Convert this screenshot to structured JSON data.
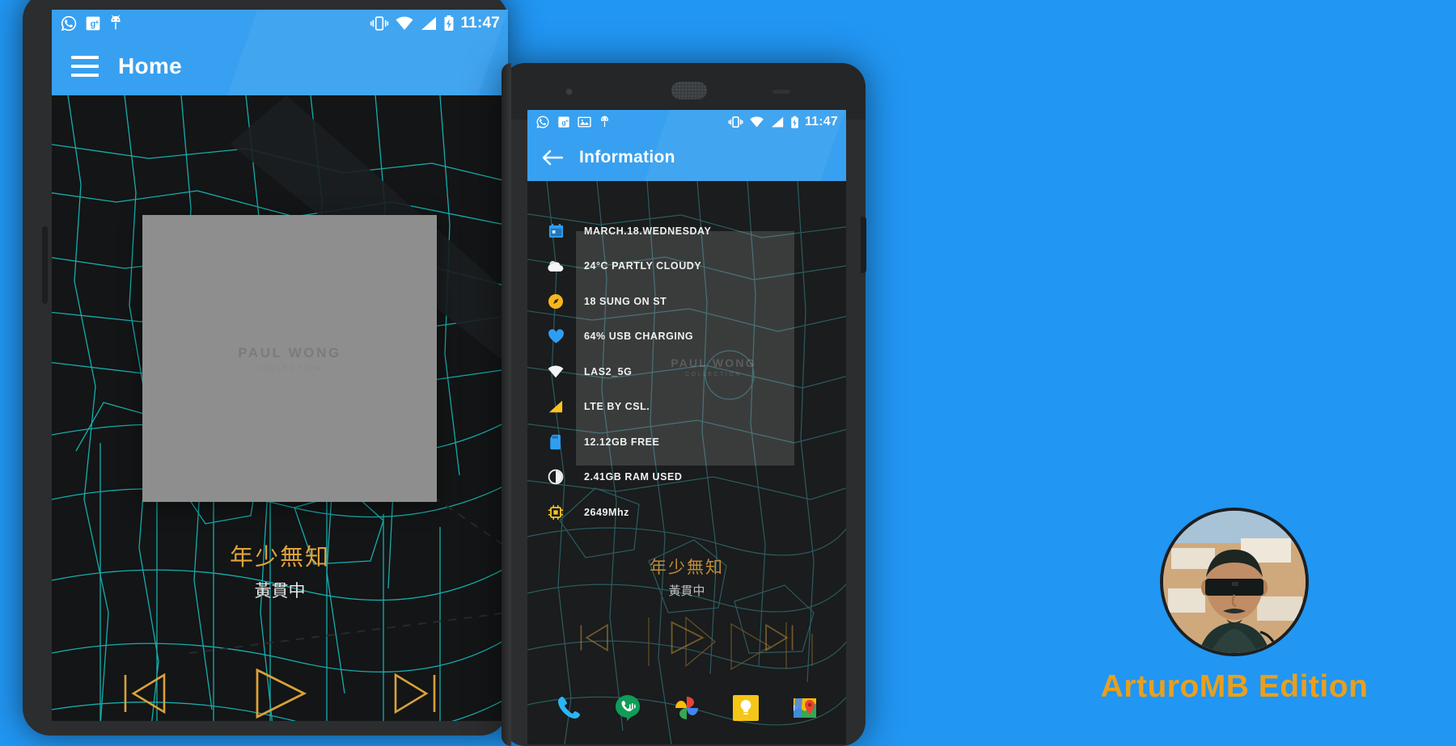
{
  "background_color": "#2196f3",
  "phone1": {
    "statusbar": {
      "time": "11:47",
      "left_icons": [
        "whatsapp-icon",
        "google-plus-icon",
        "android-icon"
      ],
      "right_icons": [
        "vibrate-icon",
        "wifi-icon",
        "signal-icon",
        "battery-charging-icon"
      ]
    },
    "appbar": {
      "title": "Home",
      "menu_icon": "hamburger-menu-icon"
    },
    "album": {
      "title": "PAUL WONG",
      "subtitle": "COLLECTION"
    },
    "now_playing": {
      "title": "年少無知",
      "artist": "黃貫中"
    },
    "controls": {
      "previous_label": "previous-track",
      "play_label": "play",
      "next_label": "next-track"
    }
  },
  "phone2": {
    "statusbar": {
      "time": "11:47",
      "left_icons": [
        "whatsapp-icon",
        "google-plus-icon",
        "screenshot-icon",
        "android-icon"
      ],
      "right_icons": [
        "vibrate-icon",
        "wifi-icon",
        "signal-icon",
        "battery-charging-icon"
      ]
    },
    "appbar": {
      "title": "Information",
      "back_icon": "back-arrow-icon"
    },
    "info_rows": [
      {
        "icon": "calendar-icon",
        "icon_color": "#2e9ef4",
        "label": "MARCH.18.WEDNESDAY"
      },
      {
        "icon": "cloud-icon",
        "icon_color": "#f2f2f2",
        "label": "24°C PARTLY CLOUDY"
      },
      {
        "icon": "compass-icon",
        "icon_color": "#f6b61c",
        "label": "18 SUNG ON ST"
      },
      {
        "icon": "heart-icon",
        "icon_color": "#2e9ef4",
        "label": "64% USB CHARGING"
      },
      {
        "icon": "wifi-icon",
        "icon_color": "#f2f2f2",
        "label": "LAS2_5G"
      },
      {
        "icon": "signal-icon",
        "icon_color": "#f6c424",
        "label": "LTE BY CSL."
      },
      {
        "icon": "sdcard-icon",
        "icon_color": "#2e9ef4",
        "label": "12.12GB FREE"
      },
      {
        "icon": "ram-gauge-icon",
        "icon_color": "#f2f2f2",
        "label": "2.41GB RAM USED"
      },
      {
        "icon": "cpu-chip-icon",
        "icon_color": "#f6c424",
        "label": "2649Mhz"
      }
    ],
    "ghost_album": {
      "title": "PAUL WONG",
      "subtitle": "COLLECTION"
    },
    "now_playing": {
      "title": "年少無知",
      "artist": "黃貫中"
    },
    "dock": [
      {
        "icon": "phone-dialer-icon",
        "label": "Phone"
      },
      {
        "icon": "hangouts-dialer-icon",
        "label": "Hangouts Dialer"
      },
      {
        "icon": "google-photos-icon",
        "label": "Photos"
      },
      {
        "icon": "google-keep-icon",
        "label": "Keep"
      },
      {
        "icon": "google-maps-icon",
        "label": "Maps"
      }
    ]
  },
  "branding": {
    "avatar_alt": "arturomb-avatar",
    "text": "ArturoMB Edition",
    "text_color": "#e6a020"
  }
}
